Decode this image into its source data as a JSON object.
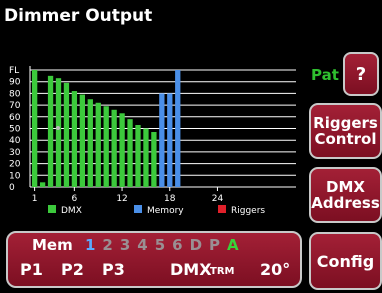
{
  "title": "Dimmer Output",
  "patch_label": "Pat",
  "buttons": {
    "help": "?",
    "riggers_line1": "Riggers",
    "riggers_line2": "Control",
    "dmx_line1": "DMX",
    "dmx_line2": "Address",
    "config": "Config"
  },
  "panel": {
    "mem_label": "Mem",
    "memory_slots": [
      {
        "label": "1",
        "color": "#5aa9ff"
      },
      {
        "label": "2",
        "color": "#9a8f93"
      },
      {
        "label": "3",
        "color": "#9a8f93"
      },
      {
        "label": "4",
        "color": "#9a8f93"
      },
      {
        "label": "5",
        "color": "#9a8f93"
      },
      {
        "label": "6",
        "color": "#9a8f93"
      },
      {
        "label": "D",
        "color": "#9a8f93"
      },
      {
        "label": "P",
        "color": "#9a8f93"
      },
      {
        "label": "A",
        "color": "#39d139"
      }
    ],
    "p1": "P1",
    "p2": "P2",
    "p3": "P3",
    "dmx": "DMX",
    "trm": "TRM",
    "temp": "20°"
  },
  "colors": {
    "dmx": "#3cc93c",
    "memory": "#4a8fe8",
    "riggers": "#e0202a",
    "button_bg": "#8d1a2c"
  },
  "chart_data": {
    "type": "bar",
    "y_tick_labels": [
      "FL",
      "90",
      "80",
      "70",
      "60",
      "50",
      "40",
      "30",
      "20",
      "10",
      "0"
    ],
    "x_tick_labels": [
      "1",
      "6",
      "12",
      "18",
      "24"
    ],
    "ylim": [
      0,
      100
    ],
    "categories": [
      1,
      2,
      3,
      4,
      5,
      6,
      7,
      8,
      9,
      10,
      11,
      12,
      13,
      14,
      15,
      16,
      17,
      18,
      19,
      20,
      21,
      22,
      23,
      24
    ],
    "series": [
      {
        "name": "DMX",
        "values": [
          100,
          4,
          95,
          93,
          89,
          82,
          79,
          75,
          72,
          69,
          66,
          63,
          58,
          53,
          50,
          47,
          0,
          0,
          0,
          0,
          0,
          0,
          0,
          0
        ]
      },
      {
        "name": "Memory",
        "values": [
          0,
          0,
          0,
          0,
          0,
          0,
          0,
          0,
          0,
          0,
          0,
          0,
          0,
          0,
          0,
          0,
          80,
          80,
          100,
          0,
          0,
          0,
          0,
          0
        ]
      },
      {
        "name": "Riggers",
        "values": [
          0,
          0,
          0,
          0,
          0,
          0,
          0,
          0,
          0,
          0,
          0,
          0,
          0,
          0,
          0,
          0,
          0,
          0,
          0,
          0,
          0,
          0,
          0,
          0
        ]
      }
    ],
    "legend": [
      "DMX",
      "Memory",
      "Riggers"
    ],
    "legend_placement": "bottom",
    "grid": true
  }
}
